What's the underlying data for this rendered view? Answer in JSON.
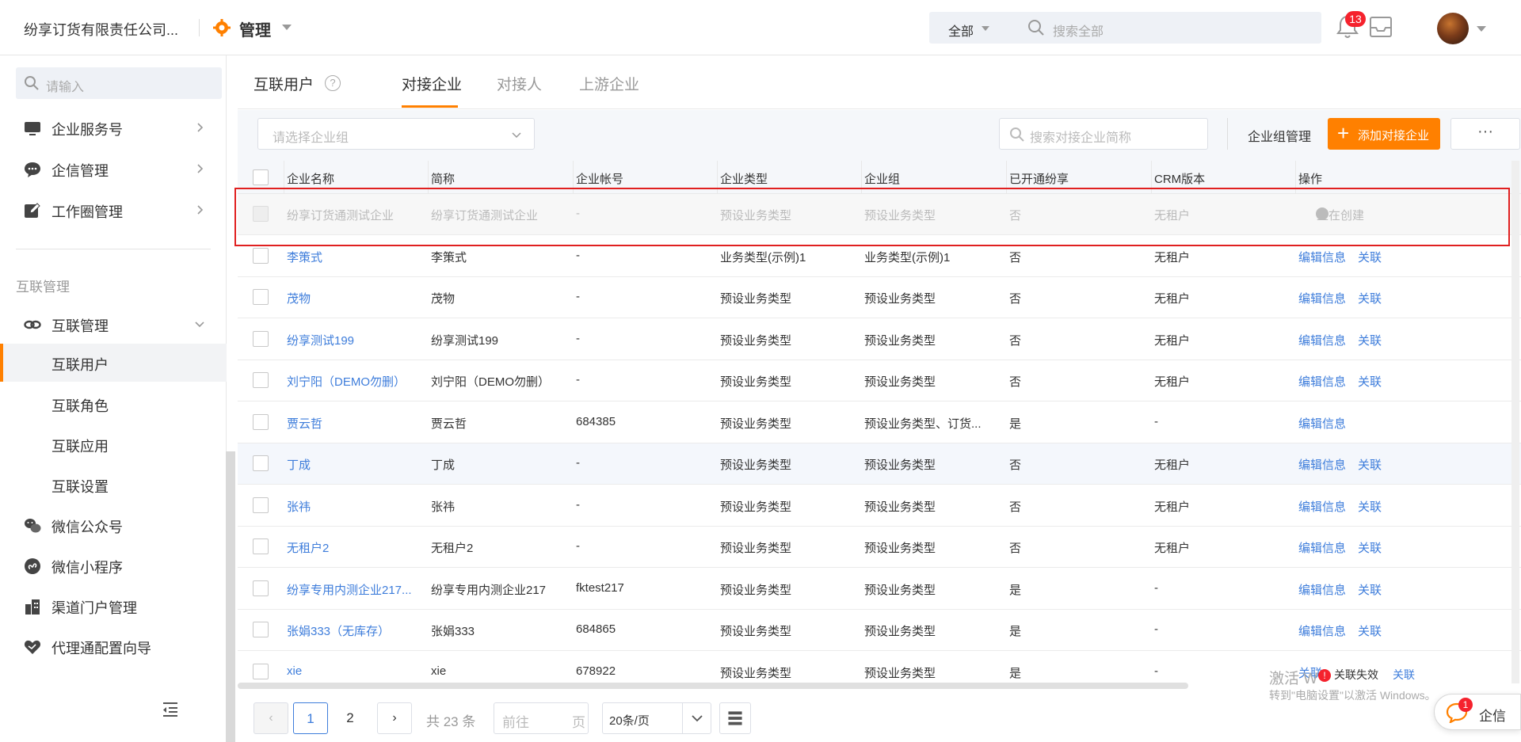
{
  "header": {
    "company": "纷享订货有限责任公司...",
    "app_title": "管理",
    "search_scope": "全部",
    "search_placeholder": "搜索全部",
    "notification_count": "13"
  },
  "sidebar": {
    "search_placeholder": "请输入",
    "items": [
      {
        "label": "企业服务号",
        "icon": "monitor-icon"
      },
      {
        "label": "企信管理",
        "icon": "chat-bubble-icon"
      },
      {
        "label": "工作圈管理",
        "icon": "edit-icon"
      }
    ],
    "group_title": "互联管理",
    "group_item": "互联管理",
    "sub_items": [
      "互联用户",
      "互联角色",
      "互联应用",
      "互联设置"
    ],
    "bottom_items": [
      {
        "label": "微信公众号",
        "icon": "wechat-icon"
      },
      {
        "label": "微信小程序",
        "icon": "mini-program-icon"
      },
      {
        "label": "渠道门户管理",
        "icon": "building-icon"
      },
      {
        "label": "代理通配置向导",
        "icon": "heart-handshake-icon"
      }
    ]
  },
  "main": {
    "page_title": "互联用户",
    "tabs": [
      "对接企业",
      "对接人",
      "上游企业"
    ],
    "active_tab": "对接企业",
    "group_select_placeholder": "请选择企业组",
    "company_search_placeholder": "搜索对接企业简称",
    "group_manage": "企业组管理",
    "add_button": "添加对接企业",
    "more_button": "···"
  },
  "table": {
    "columns": [
      "企业名称",
      "简称",
      "企业帐号",
      "企业类型",
      "企业组",
      "已开通纷享",
      "CRM版本",
      "操作"
    ],
    "rows": [
      {
        "name": "纷享订货通测试企业",
        "short": "纷享订货通测试企业",
        "account": "-",
        "type": "预设业务类型",
        "group": "预设业务类型",
        "opened": "否",
        "crm": "无租户",
        "actions": [
          "正在创建"
        ]
      },
      {
        "name": "李策式",
        "short": "李策式",
        "account": "-",
        "type": "业务类型(示例)1",
        "group": "业务类型(示例)1",
        "opened": "否",
        "crm": "无租户",
        "actions": [
          "编辑信息",
          "关联"
        ]
      },
      {
        "name": "茂物",
        "short": "茂物",
        "account": "-",
        "type": "预设业务类型",
        "group": "预设业务类型",
        "opened": "否",
        "crm": "无租户",
        "actions": [
          "编辑信息",
          "关联"
        ]
      },
      {
        "name": "纷享测试199",
        "short": "纷享测试199",
        "account": "-",
        "type": "预设业务类型",
        "group": "预设业务类型",
        "opened": "否",
        "crm": "无租户",
        "actions": [
          "编辑信息",
          "关联"
        ]
      },
      {
        "name": "刘宁阳（DEMO勿删）",
        "short": "刘宁阳（DEMO勿删）",
        "account": "-",
        "type": "预设业务类型",
        "group": "预设业务类型",
        "opened": "否",
        "crm": "无租户",
        "actions": [
          "编辑信息",
          "关联"
        ]
      },
      {
        "name": "贾云哲",
        "short": "贾云哲",
        "account": "684385",
        "type": "预设业务类型",
        "group": "预设业务类型、订货...",
        "opened": "是",
        "crm": "-",
        "actions": [
          "编辑信息"
        ]
      },
      {
        "name": "丁成",
        "short": "丁成",
        "account": "-",
        "type": "预设业务类型",
        "group": "预设业务类型",
        "opened": "否",
        "crm": "无租户",
        "actions": [
          "编辑信息",
          "关联"
        ]
      },
      {
        "name": "张祎",
        "short": "张祎",
        "account": "-",
        "type": "预设业务类型",
        "group": "预设业务类型",
        "opened": "否",
        "crm": "无租户",
        "actions": [
          "编辑信息",
          "关联"
        ]
      },
      {
        "name": "无租户2",
        "short": "无租户2",
        "account": "-",
        "type": "预设业务类型",
        "group": "预设业务类型",
        "opened": "否",
        "crm": "无租户",
        "actions": [
          "编辑信息",
          "关联"
        ]
      },
      {
        "name": "纷享专用内测企业217...",
        "short": "纷享专用内测企业217",
        "account": "fktest217",
        "type": "预设业务类型",
        "group": "预设业务类型",
        "opened": "是",
        "crm": "-",
        "actions": [
          "编辑信息",
          "关联"
        ]
      },
      {
        "name": "张娟333（无库存）",
        "short": "张娟333",
        "account": "684865",
        "type": "预设业务类型",
        "group": "预设业务类型",
        "opened": "是",
        "crm": "-",
        "actions": [
          "编辑信息",
          "关联"
        ]
      },
      {
        "name": "xie",
        "short": "xie",
        "account": "678922",
        "type": "预设业务类型",
        "group": "预设业务类型",
        "opened": "是",
        "crm": "-",
        "actions": [
          "关联"
        ]
      }
    ]
  },
  "pager": {
    "prev": "‹",
    "pages": [
      "1",
      "2"
    ],
    "next": "›",
    "total": "共 23 条",
    "goto_placeholder": "前往",
    "goto_unit": "页",
    "page_size": "20条/页"
  },
  "overlay": {
    "watermark_line1": "激活 W",
    "watermark_line2": "转到\"电脑设置\"以激活 Windows。",
    "toast_text": "关联失效",
    "toast_link": "关联",
    "qixin_label": "企信",
    "qixin_badge": "1"
  },
  "colors": {
    "accent": "#ff8000",
    "link": "#3e7ddb",
    "highlight_border": "#e02020"
  }
}
